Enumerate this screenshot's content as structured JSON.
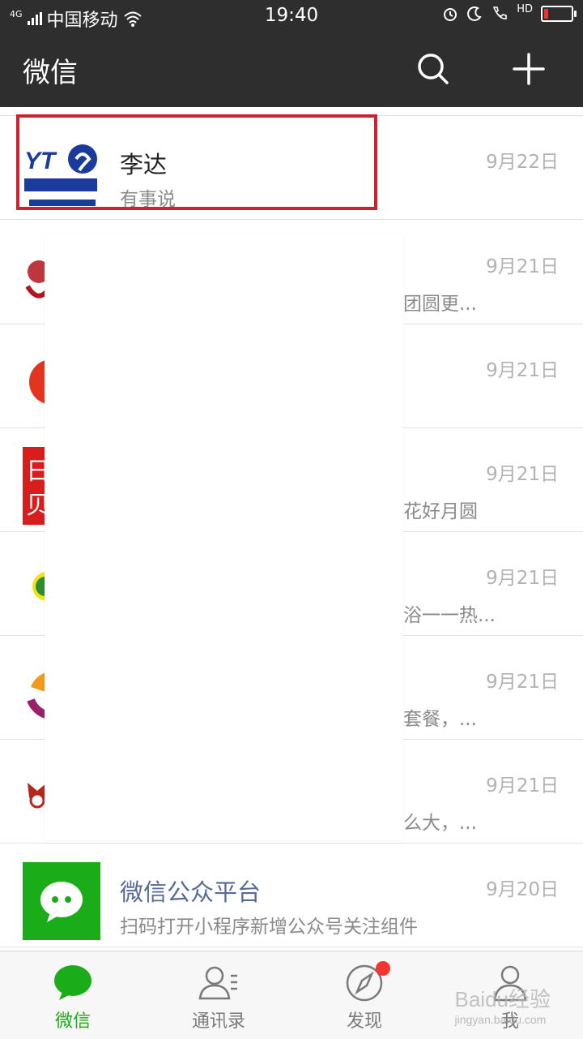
{
  "status_bar": {
    "network": "4G",
    "carrier": "中国移动",
    "time": "19:40",
    "hd_label": "HD"
  },
  "header": {
    "title": "微信",
    "search_icon": "search-icon",
    "add_icon": "plus-icon"
  },
  "chats": [
    {
      "name": "李达",
      "message": "有事说",
      "date": "9月22日",
      "avatar": "yto-express-logo"
    },
    {
      "name": "",
      "message": "团圆更...",
      "date": "9月21日",
      "avatar": "red-seal"
    },
    {
      "name": "",
      "message": "",
      "date": "9月21日",
      "avatar": "red-circle"
    },
    {
      "name": "",
      "message": "花好月圆",
      "date": "9月21日",
      "avatar": "red-square"
    },
    {
      "name": "",
      "message": "浴一一热...",
      "date": "9月21日",
      "avatar": "green-yellow-logo"
    },
    {
      "name": "",
      "message": "套餐，...",
      "date": "9月21日",
      "avatar": "orange-purple-logo"
    },
    {
      "name": "",
      "message": "么大，...",
      "date": "9月21日",
      "avatar": "red-bull-logo"
    },
    {
      "name": "微信公众平台",
      "message": "扫码打开小程序新增公众号关注组件",
      "date": "9月20日",
      "avatar": "wechat-green-icon"
    }
  ],
  "tabs": [
    {
      "label": "微信",
      "icon": "chat-bubble-icon",
      "active": true
    },
    {
      "label": "通讯录",
      "icon": "contacts-icon",
      "active": false
    },
    {
      "label": "发现",
      "icon": "compass-icon",
      "active": false,
      "badge": true
    },
    {
      "label": "我",
      "icon": "person-icon",
      "active": false
    }
  ],
  "watermark": {
    "text": "Baidu经验",
    "sub": "jingyan.baidu.com"
  },
  "colors": {
    "header_bg": "#2e2e2e",
    "accent_green": "#1aad19",
    "highlight": "#cc2230",
    "badge": "#f43530"
  }
}
